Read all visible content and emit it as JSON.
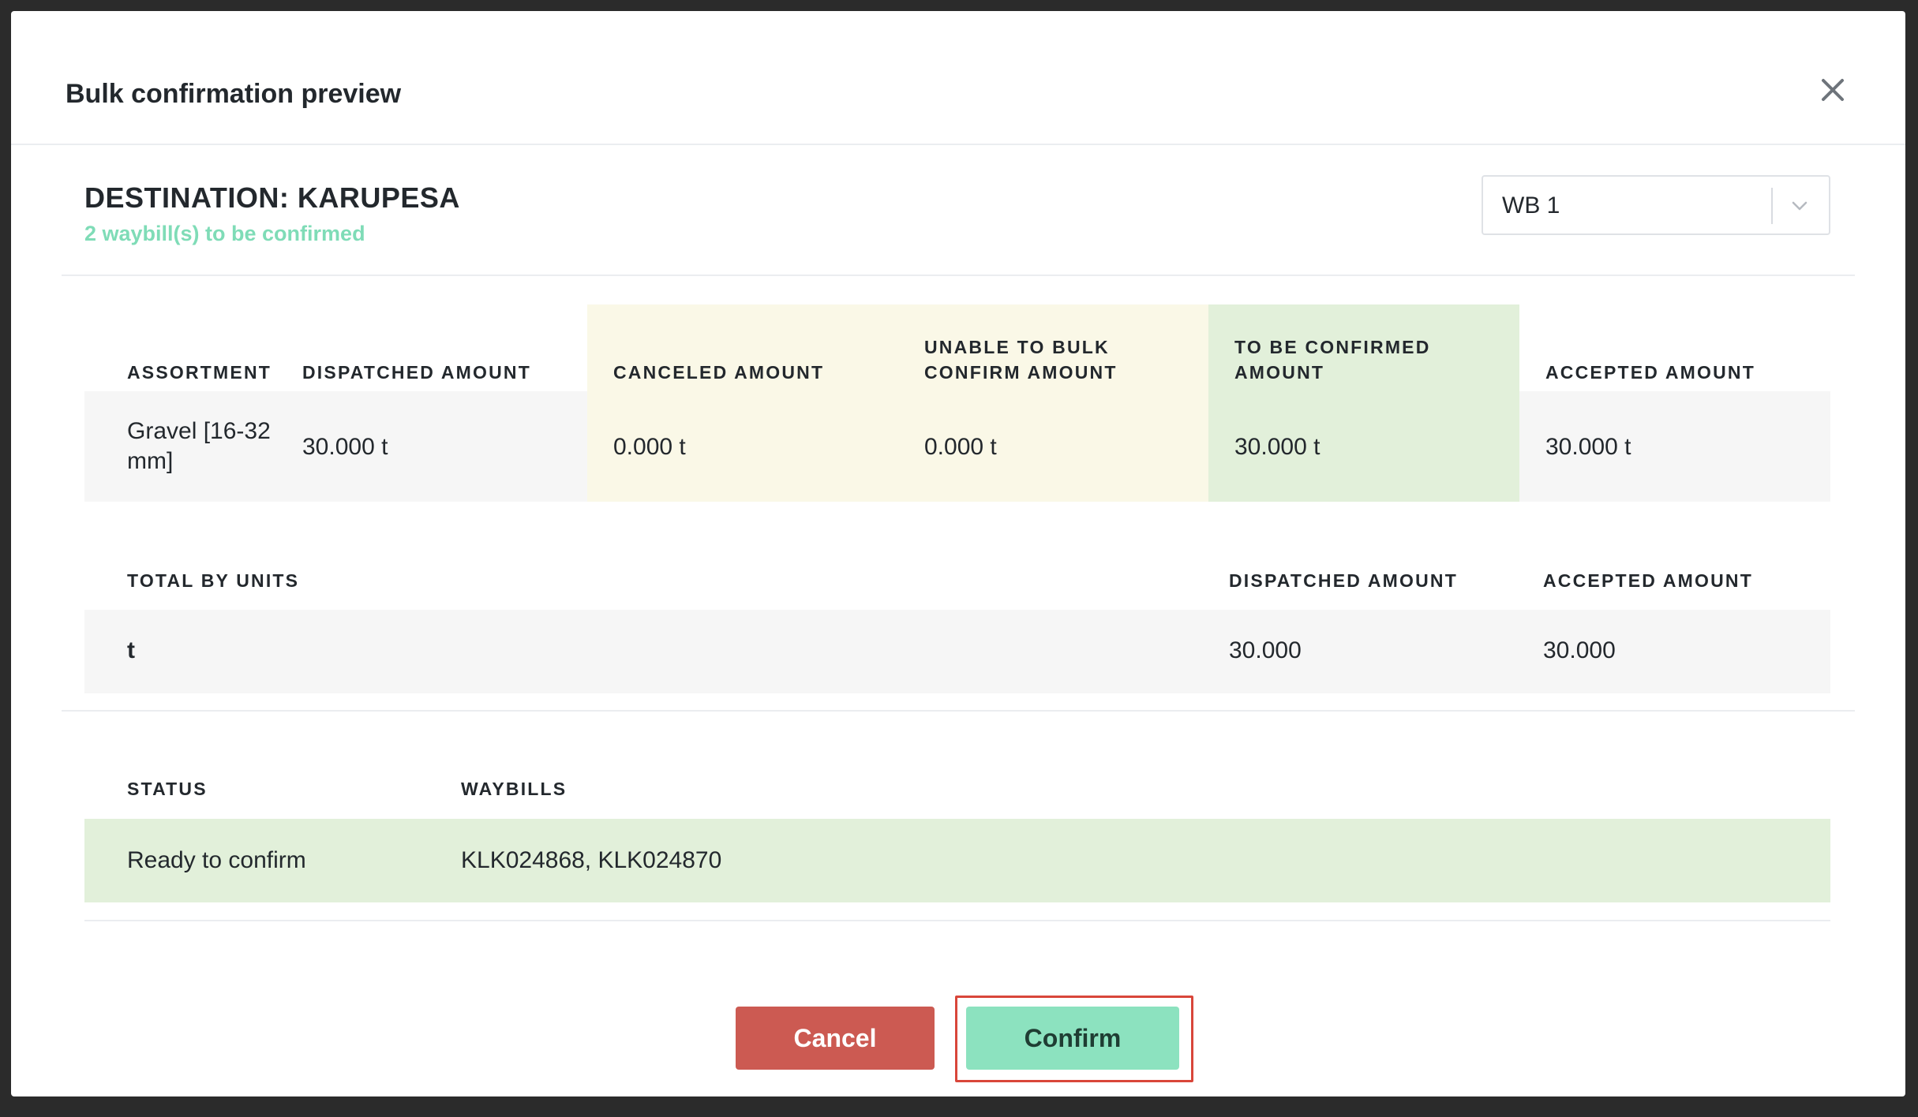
{
  "modal": {
    "title": "Bulk confirmation preview"
  },
  "destination": {
    "title": "DESTINATION: KARUPESA",
    "subtitle": "2 waybill(s) to be confirmed",
    "select_value": "WB 1"
  },
  "assortment_table": {
    "headers": {
      "assortment": "ASSORTMENT",
      "dispatched": "DISPATCHED AMOUNT",
      "canceled": "CANCELED AMOUNT",
      "unable_line1": "UNABLE TO BULK",
      "unable_line2": "CONFIRM AMOUNT",
      "to_confirm_line1": "TO BE CONFIRMED",
      "to_confirm_line2": "AMOUNT",
      "accepted": "ACCEPTED AMOUNT"
    },
    "rows": [
      {
        "assortment_line1": "Gravel [16-32",
        "assortment_line2": "mm]",
        "dispatched": "30.000 t",
        "canceled": "0.000 t",
        "unable": "0.000 t",
        "to_confirm": "30.000 t",
        "accepted": "30.000 t"
      }
    ]
  },
  "totals_table": {
    "headers": {
      "total_by_units": "TOTAL BY UNITS",
      "dispatched": "DISPATCHED AMOUNT",
      "accepted": "ACCEPTED AMOUNT"
    },
    "rows": [
      {
        "unit": "t",
        "dispatched": "30.000",
        "accepted": "30.000"
      }
    ]
  },
  "status_table": {
    "headers": {
      "status": "STATUS",
      "waybills": "WAYBILLS"
    },
    "rows": [
      {
        "status": "Ready to confirm",
        "waybills": "KLK024868, KLK024870"
      }
    ]
  },
  "footer": {
    "cancel_label": "Cancel",
    "confirm_label": "Confirm"
  },
  "colors": {
    "accent_green": "#8ce2bf",
    "cancel_red": "#cc5a52",
    "highlight_red": "#d9463a",
    "yellow_band": "#faf8e7",
    "green_band": "#e2f0da"
  },
  "icons": {
    "close": "close-icon",
    "dropdown": "chevron-down-icon"
  }
}
